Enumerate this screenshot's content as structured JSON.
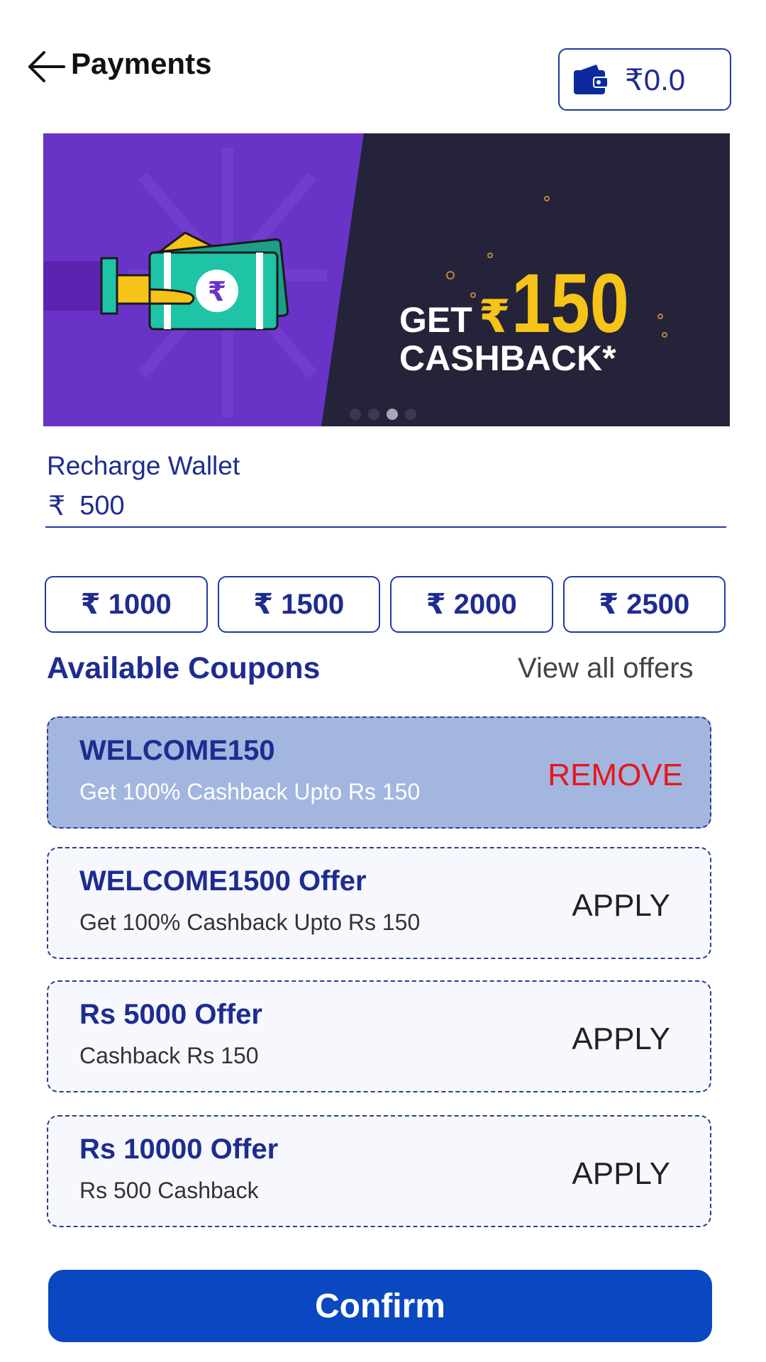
{
  "header": {
    "title": "Payments",
    "wallet_balance": "₹0.0"
  },
  "banner": {
    "get_label": "GET",
    "currency": "₹",
    "amount": "150",
    "cashback_label": "CASHBACK*",
    "active_slide": 3,
    "slide_count": 4,
    "colors": {
      "left": "#6a33c8",
      "right": "#242339",
      "accent": "#f6c318",
      "note": "#1fc3a6"
    }
  },
  "recharge": {
    "label": "Recharge Wallet",
    "currency": "₹",
    "value": "500"
  },
  "quick_amounts": [
    {
      "label": "₹  1000"
    },
    {
      "label": "₹  1500"
    },
    {
      "label": "₹  2000"
    },
    {
      "label": "₹  2500"
    }
  ],
  "coupons_section": {
    "title": "Available Coupons",
    "view_all": "View all offers"
  },
  "coupons": [
    {
      "code": "WELCOME150",
      "desc": "Get 100% Cashback Upto Rs 150",
      "action": "REMOVE",
      "applied": true
    },
    {
      "code": "WELCOME1500 Offer",
      "desc": "Get 100% Cashback Upto Rs 150",
      "action": "APPLY",
      "applied": false
    },
    {
      "code": "Rs 5000 Offer",
      "desc": "Cashback  Rs 150",
      "action": "APPLY",
      "applied": false
    },
    {
      "code": "Rs 10000 Offer",
      "desc": "Rs 500 Cashback",
      "action": "APPLY",
      "applied": false
    }
  ],
  "confirm_label": "Confirm",
  "icons": {
    "back": "arrow-left-icon",
    "wallet": "wallet-icon",
    "hand": "hand-with-money-icon"
  },
  "theme": {
    "primary": "#1e2c91",
    "button": "#0a48c1",
    "applied_bg": "#a3b6df",
    "remove": "#e8151b"
  }
}
